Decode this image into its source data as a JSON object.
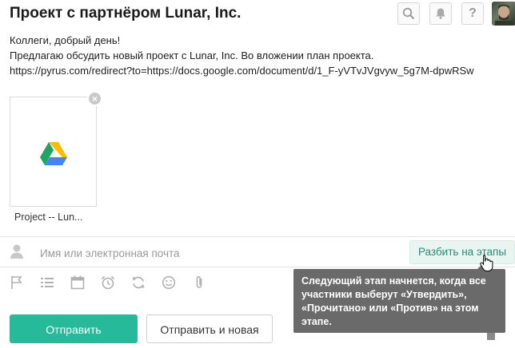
{
  "header": {
    "title": "Проект с партнёром Lunar, Inc.",
    "buttons": [
      {
        "name": "search",
        "icon": "search-icon"
      },
      {
        "name": "notifications",
        "icon": "bell-icon"
      },
      {
        "name": "help",
        "icon": "help-icon",
        "label": "?"
      }
    ],
    "avatar_icon": "avatar"
  },
  "message": {
    "line1": "Коллеги, добрый день!",
    "line2": "Предлагаю обсудить новый проект с Lunar, Inc. Во вложении план проекта.",
    "line3": "https://pyrus.com/redirect?to=https://docs.google.com/document/d/1_F-yVTvJVgvyw_5g7M-dpwRSw"
  },
  "attachment": {
    "name": "Project -- Lun...",
    "icon": "google-drive-icon",
    "remove_label": "×"
  },
  "participants": {
    "placeholder": "Имя или электронная почта",
    "stages_button": "Разбить на этапы"
  },
  "toolbar": {
    "icons": [
      "flag-icon",
      "list-icon",
      "calendar-icon",
      "alarm-icon",
      "repeat-icon",
      "smile-icon",
      "paperclip-icon"
    ]
  },
  "tooltip": {
    "text": "Следующий этап начнется, когда все участники выберут «Утвердить», «Прочитано» или «Против» на этом этапе."
  },
  "actions": {
    "send": "Отправить",
    "send_and_new": "Отправить и новая"
  },
  "colors": {
    "accent": "#26b99a",
    "accent_text": "#1f8f77",
    "tooltip_bg": "#6a6a6a"
  }
}
